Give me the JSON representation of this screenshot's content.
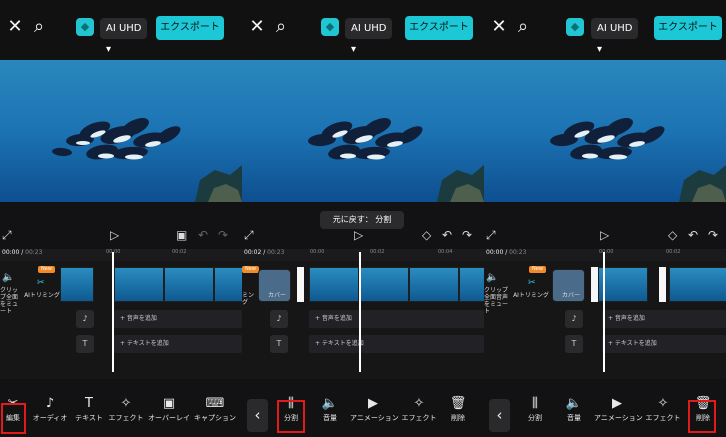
{
  "panels": [
    {
      "quality": "AI UHD",
      "export": "エクスポート",
      "time": {
        "current": "00:00",
        "total": "00:23"
      },
      "ticks": [
        "00:00",
        "00:02"
      ],
      "track_labels": [
        "クリップ全面をミュート",
        "AIトリミング"
      ],
      "new_badge": "New",
      "lanes": [
        "+ 音声を追加",
        "+ テキストを追加"
      ],
      "tools": [
        "編集",
        "オーディオ",
        "テキスト",
        "エフェクト",
        "オーバーレイ",
        "キャプション"
      ]
    },
    {
      "quality": "AI UHD",
      "export": "エクスポート",
      "toast": "元に戻す： 分割",
      "time": {
        "current": "00:02",
        "total": "00:23"
      },
      "ticks": [
        "00:00",
        "00:02",
        "00:04"
      ],
      "track_labels": [
        "ミング",
        "カバー"
      ],
      "new_badge": "New",
      "lanes": [
        "+ 音声を追加",
        "+ テキストを追加"
      ],
      "tools": [
        "分割",
        "音量",
        "アニメーション",
        "エフェクト",
        "削除"
      ]
    },
    {
      "quality": "AI UHD",
      "export": "エクスポート",
      "time": {
        "current": "00:00",
        "total": "00:23"
      },
      "ticks": [
        "00:00",
        "00:02"
      ],
      "track_labels": [
        "クリップ全面音声をミュート",
        "AIトリミング",
        "カバー"
      ],
      "new_badge": "New",
      "lanes": [
        "+ 音声を追加",
        "+ テキストを追加"
      ],
      "tools": [
        "分割",
        "音量",
        "アニメーション",
        "エフェクト",
        "削除"
      ]
    }
  ],
  "colors": {
    "accent": "#1cc8d6",
    "highlight": "#e11b1b",
    "new": "#f28a27"
  }
}
